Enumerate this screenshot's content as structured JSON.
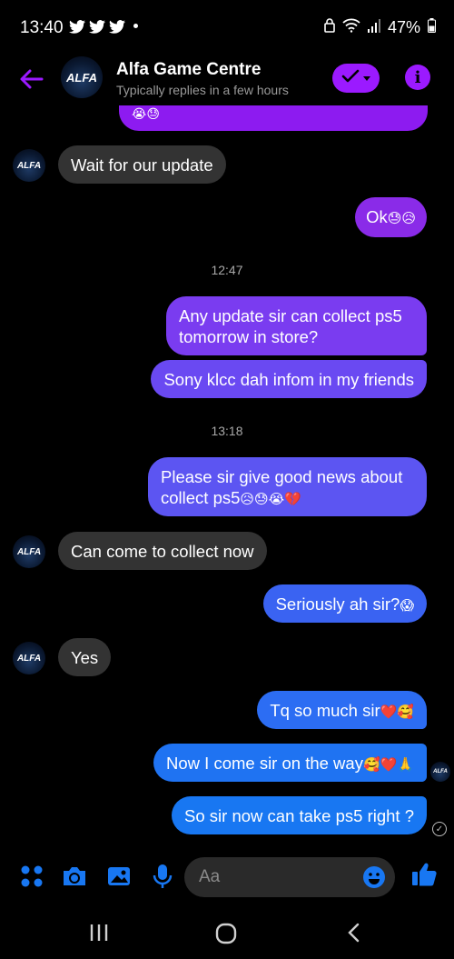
{
  "status_bar": {
    "time": "13:40",
    "battery": "47%"
  },
  "header": {
    "name": "Alfa Game Centre",
    "subtitle": "Typically replies in a few hours",
    "avatar_text": "ALFA"
  },
  "colors": {
    "purple": "#9b1aff",
    "blue": "#1877f2",
    "incoming": "#333333"
  },
  "messages": [
    {
      "dir": "in",
      "text": "Wait for our update"
    },
    {
      "dir": "out",
      "text": "Ok",
      "emoji": "😓😥"
    },
    {
      "time": "12:47"
    },
    {
      "dir": "out",
      "text": "Any update sir can collect ps5 tomorrow in store?"
    },
    {
      "dir": "out",
      "text": "Sony klcc dah infom in my friends"
    },
    {
      "time": "13:18"
    },
    {
      "dir": "out",
      "text": "Please sir give good news about collect ps5",
      "emoji": "😥😓😭💔"
    },
    {
      "dir": "in",
      "text": "Can come to collect now"
    },
    {
      "dir": "out",
      "text": "Seriously ah sir?",
      "emoji": "😱"
    },
    {
      "dir": "in",
      "text": "Yes"
    },
    {
      "dir": "out",
      "text": "Tq so much sir",
      "emoji": "❤️🥰"
    },
    {
      "dir": "out",
      "text": "Now I come sir on the way",
      "emoji": "🥰❤️🙏"
    },
    {
      "dir": "out",
      "text": "So sir now can take ps5 right ?"
    }
  ],
  "composer": {
    "placeholder": "Aa",
    "icons": [
      "apps-icon",
      "camera-icon",
      "gallery-icon",
      "mic-icon",
      "emoji-icon",
      "like-icon"
    ]
  },
  "nav": {
    "icons": [
      "recent-apps-icon",
      "home-icon",
      "back-icon"
    ]
  }
}
